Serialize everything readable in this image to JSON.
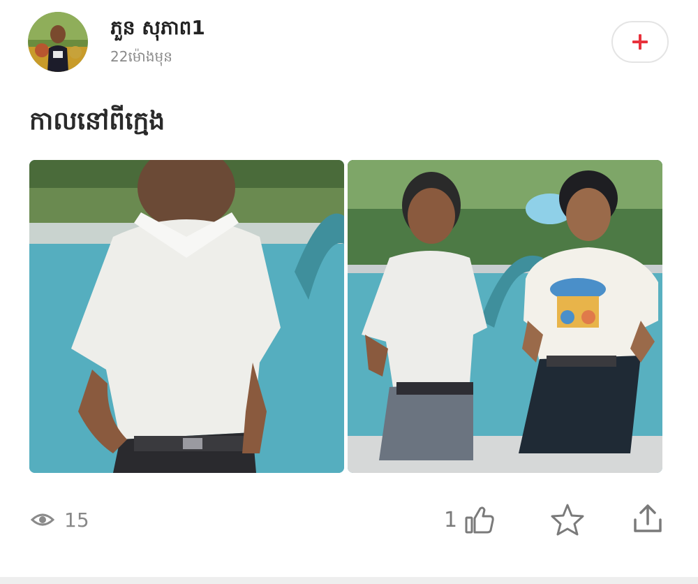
{
  "author": {
    "name": "ភួន សុភាព1",
    "time": "22ម៉ោងមុន"
  },
  "post": {
    "text": "កាលនៅពីក្មេង"
  },
  "stats": {
    "views": "15",
    "likes": "1"
  },
  "icons": {
    "follow": "plus-icon",
    "views": "eye-icon",
    "like": "thumbs-up-icon",
    "favorite": "star-icon",
    "share": "share-upload-icon"
  },
  "colors": {
    "accent": "#e8323c",
    "icon": "#7a7a7a"
  }
}
